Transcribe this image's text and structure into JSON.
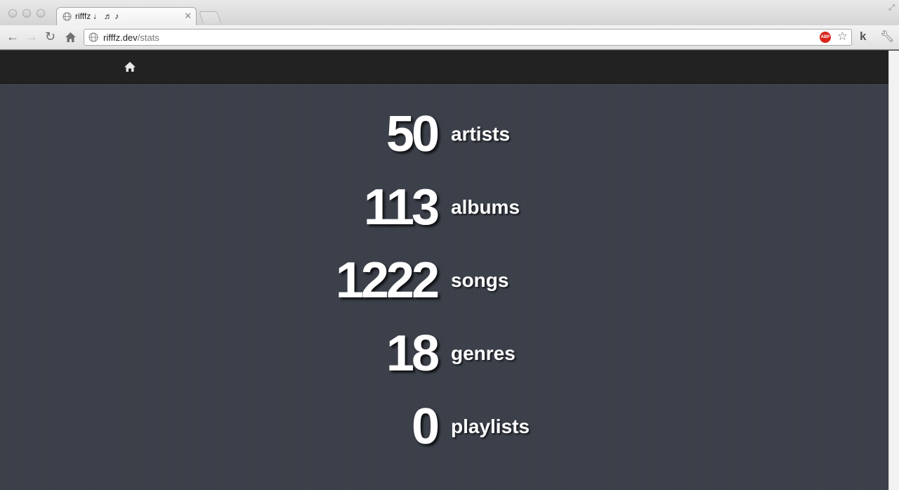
{
  "browser": {
    "tab_title": "rifffz ♩ ♬ ♪",
    "url_host": "rifffz.dev",
    "url_path": "/stats",
    "extension_k": "k",
    "abp_label": "ABP"
  },
  "navbar": {
    "home_icon": "home-icon"
  },
  "stats": [
    {
      "value": "50",
      "label": "artists"
    },
    {
      "value": "113",
      "label": "albums"
    },
    {
      "value": "1222",
      "label": "songs"
    },
    {
      "value": "18",
      "label": "genres"
    },
    {
      "value": "0",
      "label": "playlists"
    }
  ]
}
